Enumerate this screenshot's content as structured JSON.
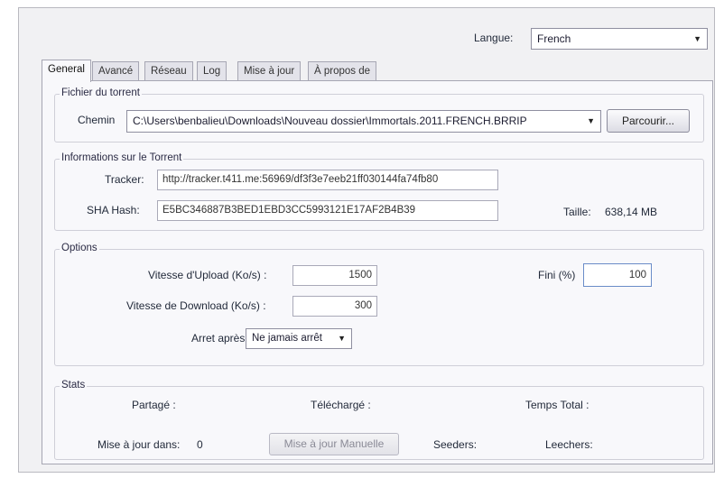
{
  "language": {
    "label": "Langue:",
    "value": "French"
  },
  "tabs": [
    {
      "label": "General",
      "active": true
    },
    {
      "label": "Avancé",
      "active": false
    },
    {
      "label": "Réseau",
      "active": false
    },
    {
      "label": "Log",
      "active": false
    },
    {
      "label": "Mise à jour",
      "active": false
    },
    {
      "label": "À propos de",
      "active": false
    }
  ],
  "torrent_file": {
    "group_title": "Fichier du torrent",
    "path_label": "Chemin",
    "path_value": "C:\\Users\\benbalieu\\Downloads\\Nouveau dossier\\Immortals.2011.FRENCH.BRRIP",
    "browse_label": "Parcourir..."
  },
  "torrent_info": {
    "group_title": "Informations sur le Torrent",
    "tracker_label": "Tracker:",
    "tracker_value": "http://tracker.t411.me:56969/df3f3e7eeb21ff030144fa74fb80",
    "hash_label": "SHA Hash:",
    "hash_value": "E5BC346887B3BED1EBD3CC5993121E17AF2B4B39",
    "size_label": "Taille:",
    "size_value": "638,14 MB"
  },
  "options": {
    "group_title": "Options",
    "upload_label": "Vitesse d'Upload (Ko/s) :",
    "upload_value": "1500",
    "download_label": "Vitesse de Download (Ko/s) :",
    "download_value": "300",
    "stop_label": "Arret après:",
    "stop_value": "Ne jamais arrêt",
    "finish_label": "Fini (%)",
    "finish_value": "100"
  },
  "stats": {
    "group_title": "Stats",
    "shared_label": "Partagé :",
    "downloaded_label": "Téléchargé :",
    "total_time_label": "Temps Total :",
    "update_in_label": "Mise à jour dans:",
    "update_in_value": "0",
    "manual_update_label": "Mise à jour Manuelle",
    "seeders_label": "Seeders:",
    "leechers_label": "Leechers:"
  }
}
